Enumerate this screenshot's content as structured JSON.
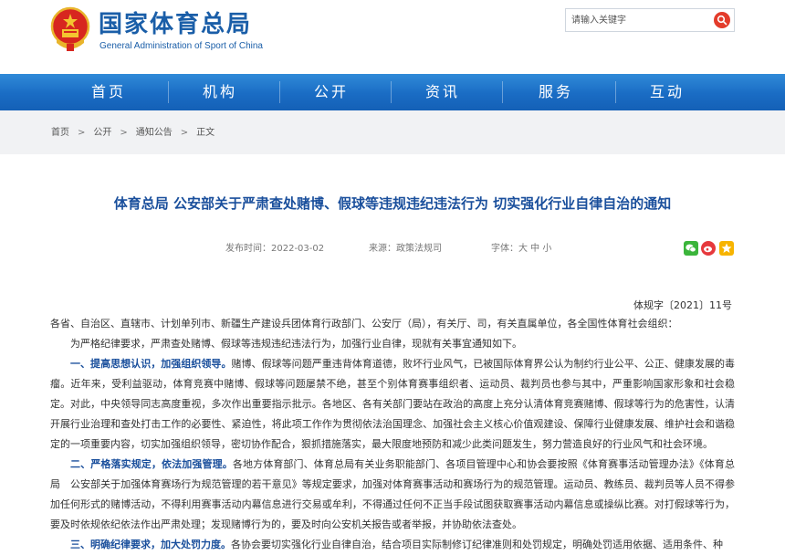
{
  "header": {
    "site_title_cn": "国家体育总局",
    "site_title_en": "General Administration of Sport of China",
    "search_placeholder": "请输入关键字"
  },
  "nav": {
    "items": [
      "首页",
      "机构",
      "公开",
      "资讯",
      "服务",
      "互动"
    ]
  },
  "breadcrumb": {
    "items": [
      "首页",
      "公开",
      "通知公告",
      "正文"
    ],
    "separator": ">"
  },
  "article": {
    "title": "体育总局 公安部关于严肃查处赌博、假球等违规违纪违法行为 切实强化行业自律自治的通知",
    "publish_date": "发布时间：2022-03-02",
    "source": "来源：政策法规司",
    "font_size_control": "字体：大 中 小",
    "doc_number": "体规字〔2021〕11号",
    "addressee": "各省、自治区、直辖市、计划单列市、新疆生产建设兵团体育行政部门、公安厅（局），有关厅、司，有关直属单位，各全国性体育社会组织：",
    "intro": "为严格纪律要求，严肃查处赌博、假球等违规违纪违法行为，加强行业自律，现就有关事宜通知如下。",
    "sections": [
      {
        "heading": "一、提高思想认识，加强组织领导。",
        "text": "赌博、假球等问题严重违背体育道德，败坏行业风气，已被国际体育界公认为制约行业公平、公正、健康发展的毒瘤。近年来，受利益驱动，体育竞赛中赌博、假球等问题屡禁不绝，甚至个别体育赛事组织者、运动员、裁判员也参与其中，严重影响国家形象和社会稳定。对此，中央领导同志高度重视，多次作出重要指示批示。各地区、各有关部门要站在政治的高度上充分认清体育竞赛赌博、假球等行为的危害性，认清开展行业治理和查处打击工作的必要性、紧迫性，将此项工作作为贯彻依法治国理念、加强社会主义核心价值观建设、保障行业健康发展、维护社会和谐稳定的一项重要内容，切实加强组织领导，密切协作配合，狠抓措施落实，最大限度地预防和减少此类问题发生，努力营造良好的行业风气和社会环境。"
      },
      {
        "heading": "二、严格落实规定，依法加强管理。",
        "text": "各地方体育部门、体育总局有关业务职能部门、各项目管理中心和协会要按照《体育赛事活动管理办法》《体育总局　公安部关于加强体育赛场行为规范管理的若干意见》等规定要求，加强对体育赛事活动和赛场行为的规范管理。运动员、教练员、裁判员等人员不得参加任何形式的赌博活动，不得利用赛事活动内幕信息进行交易或牟利，不得通过任何不正当手段试图获取赛事活动内幕信息或操纵比赛。对打假球等行为，要及时依规依纪依法作出严肃处理；发现赌博行为的，要及时向公安机关报告或者举报，并协助依法查处。"
      },
      {
        "heading": "三、明确纪律要求，加大处罚力度。",
        "text": "各协会要切实强化行业自律自治，结合项目实际制修订纪律准则和处罚规定，明确处罚适用依据、适用条件、种"
      }
    ]
  },
  "colors": {
    "brand_blue": "#1a5ea8",
    "nav_blue": "#1a6cc4",
    "title_blue": "#1a4f9c",
    "emblem_red": "#d7261f",
    "search_red": "#e33c2b"
  },
  "icons": [
    "national-emblem-icon",
    "search-icon",
    "wechat-icon",
    "weibo-icon",
    "qzone-icon"
  ]
}
